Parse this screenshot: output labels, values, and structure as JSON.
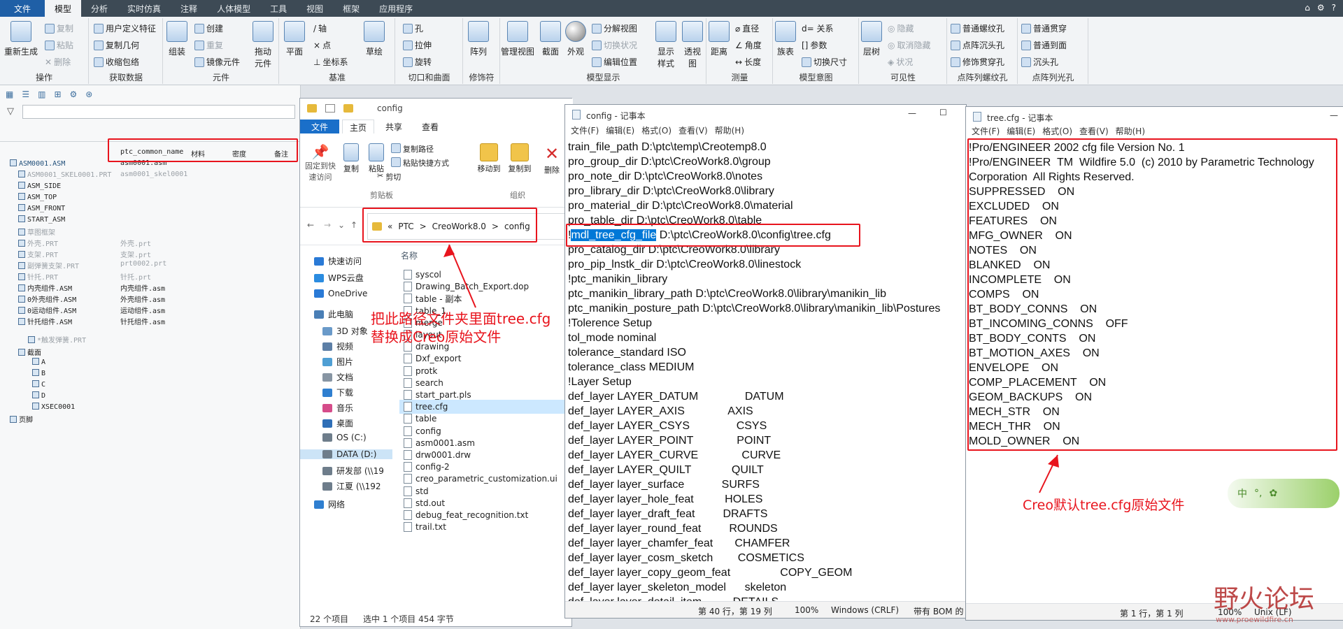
{
  "ribbon": {
    "tabs": [
      "文件",
      "模型",
      "分析",
      "实时仿真",
      "注释",
      "人体模型",
      "工具",
      "视图",
      "框架",
      "应用程序"
    ],
    "groups": {
      "operations": {
        "name": "操作",
        "regen": "重新生成",
        "copy": "复制",
        "paste": "粘贴",
        "delete": "删除"
      },
      "getdata": {
        "name": "获取数据",
        "udf": "用户定义特征",
        "copygeom": "复制几何",
        "shrinkwrap": "收缩包络"
      },
      "component": {
        "name": "元件",
        "assemble": "组装",
        "create": "创建",
        "repeat": "重复",
        "mirror": "镜像元件",
        "pull": "拖动元件"
      },
      "datum": {
        "name": "基准",
        "plane": "平面",
        "axis": "轴",
        "point": "点",
        "csys": "坐标系",
        "sketch": "草绘"
      },
      "cut": {
        "name": "切口和曲面",
        "hole": "孔",
        "extrude": "拉伸",
        "revolve": "旋转"
      },
      "modifier": {
        "name": "修饰符",
        "pattern": "阵列"
      },
      "display": {
        "name": "模型显示",
        "manage": "管理视图",
        "section": "截面",
        "appearance": "外观",
        "explode": "分解视图",
        "toggle": "切换状况",
        "editpos": "编辑位置",
        "style": "显示样式",
        "persp": "透视图"
      },
      "measure": {
        "name": "测量",
        "distance": "距离",
        "diameter": "直径",
        "angle": "角度",
        "length": "长度"
      },
      "intent": {
        "name": "模型意图",
        "table": "族表",
        "rel": "d= 关系",
        "params": "参数",
        "switchdim": "切换尺寸"
      },
      "visibility": {
        "name": "可见性",
        "layer": "层树",
        "hide": "隐藏",
        "unhide": "取消隐藏",
        "status": "状况"
      },
      "holes1": {
        "name": "点阵列螺纹孔",
        "a": "普通螺纹孔",
        "b": "点阵沉头孔",
        "c": "修饰贯穿孔"
      },
      "holes2": {
        "name": "点阵列光孔",
        "a": "普通贯穿",
        "b": "普通到面",
        "c": "沉头孔"
      }
    }
  },
  "tree": {
    "columns": [
      "ptc_common_name",
      "材料",
      "密度",
      "备注"
    ],
    "rows": [
      {
        "name": "ASM0001.ASM",
        "common": "asm0001.asm",
        "style": "blue"
      },
      {
        "name": "ASM0001_SKEL0001.PRT",
        "common": "asm0001_skel0001",
        "style": "g"
      },
      {
        "name": "ASM_SIDE",
        "common": "",
        "style": ""
      },
      {
        "name": "ASM_TOP",
        "common": "",
        "style": ""
      },
      {
        "name": "ASM_FRONT",
        "common": "",
        "style": ""
      },
      {
        "name": "START_ASM",
        "common": "",
        "style": ""
      },
      {
        "name": "草图框架",
        "common": "",
        "style": "g"
      },
      {
        "name": "外壳.PRT",
        "common": "外壳.prt",
        "style": "g"
      },
      {
        "name": "支架.PRT",
        "common": "支架.prt",
        "style": "g"
      },
      {
        "name": "副弹簧支架.PRT",
        "common": "prt0002.prt",
        "style": "g"
      },
      {
        "name": "针托.PRT",
        "common": "针托.prt",
        "style": "g"
      },
      {
        "name": "内壳组件.ASM",
        "common": "内壳组件.asm",
        "style": ""
      },
      {
        "name": "0外壳组件.ASM",
        "common": "外壳组件.asm",
        "style": ""
      },
      {
        "name": "0运动组件.ASM",
        "common": "运动组件.asm",
        "style": ""
      },
      {
        "name": "针托组件.ASM",
        "common": "针托组件.asm",
        "style": ""
      },
      {
        "name": "*触发弹簧.PRT",
        "common": "",
        "style": "g"
      },
      {
        "name": "截面",
        "common": "",
        "style": ""
      },
      {
        "name": "A",
        "common": "",
        "style": ""
      },
      {
        "name": "B",
        "common": "",
        "style": ""
      },
      {
        "name": "C",
        "common": "",
        "style": ""
      },
      {
        "name": "D",
        "common": "",
        "style": ""
      },
      {
        "name": "XSEC0001",
        "common": "",
        "style": ""
      },
      {
        "name": "页脚",
        "common": "",
        "style": ""
      }
    ]
  },
  "explorer": {
    "title": "config",
    "tabs": [
      "文件",
      "主页",
      "共享",
      "查看"
    ],
    "ribbon": {
      "pin": "固定到快速访问",
      "copy": "复制",
      "paste": "粘贴",
      "copypath": "复制路径",
      "pasteshortcut": "粘贴快捷方式",
      "cut": "剪切",
      "clipboard": "剪贴板",
      "moveto": "移动到",
      "copyto": "复制到",
      "del": "删除",
      "organize": "组织"
    },
    "breadcrumb": [
      "«",
      "PTC",
      ">",
      "CreoWork8.0",
      ">",
      "config"
    ],
    "nav": [
      "快速访问",
      "WPS云盘",
      "OneDrive",
      "此电脑",
      "3D 对象",
      "视频",
      "图片",
      "文档",
      "下载",
      "音乐",
      "桌面",
      "OS (C:)",
      "DATA (D:)",
      "研发部 (\\\\19",
      "江夏 (\\\\192",
      "网络"
    ],
    "column": "名称",
    "files": [
      "syscol",
      "Drawing_Batch_Export.dop",
      "table - 副本",
      "table_1",
      "merge",
      "layout",
      "drawing",
      "Dxf_export",
      "protk",
      "search",
      "start_part.pls",
      "tree.cfg",
      "table",
      "config",
      "asm0001.asm",
      "drw0001.drw",
      "config-2",
      "creo_parametric_customization.ui",
      "std",
      "std.out",
      "debug_feat_recognition.txt",
      "trail.txt"
    ],
    "status": {
      "count": "22 个项目",
      "selected": "选中 1 个项目  454 字节"
    }
  },
  "notepad1": {
    "title": "config - 记事本",
    "menu": [
      "文件(F)",
      "编辑(E)",
      "格式(O)",
      "查看(V)",
      "帮助(H)"
    ],
    "lines": [
      "train_file_path D:\\ptc\\temp\\Creotemp8.0",
      "pro_group_dir D:\\ptc\\CreoWork8.0\\group",
      "pro_note_dir D:\\ptc\\CreoWork8.0\\notes",
      "pro_library_dir D:\\ptc\\CreoWork8.0\\library",
      "pro_material_dir D:\\ptc\\CreoWork8.0\\material",
      "pro_table_dir D:\\ptc\\CreoWork8.0\\table",
      "!mdl_tree_cfg_file D:\\ptc\\CreoWork8.0\\config\\tree.cfg",
      "pro_catalog_dir D:\\ptc\\CreoWork8.0\\library",
      "pro_pip_lnstk_dir D:\\ptc\\CreoWork8.0\\linestock",
      "!ptc_manikin_library",
      "ptc_manikin_library_path D:\\ptc\\CreoWork8.0\\library\\manikin_lib",
      "ptc_manikin_posture_path D:\\ptc\\CreoWork8.0\\library\\manikin_lib\\Postures",
      "!Tolerence Setup",
      "tol_mode nominal",
      "tolerance_standard ISO",
      "tolerance_class MEDIUM",
      "!Layer Setup",
      "def_layer LAYER_DATUM               DATUM",
      "def_layer LAYER_AXIS              AXIS",
      "def_layer LAYER_CSYS               CSYS",
      "def_layer LAYER_POINT              POINT",
      "def_layer LAYER_CURVE              CURVE",
      "def_layer LAYER_QUILT             QUILT",
      "def_layer layer_surface            SURFS",
      "def_layer layer_hole_feat          HOLES",
      "def_layer layer_draft_feat         DRAFTS",
      "def_layer layer_round_feat         ROUNDS",
      "def_layer layer_chamfer_feat       CHAMFER",
      "def_layer layer_cosm_sketch        COSMETICS",
      "def_layer layer_copy_geom_feat                COPY_GEOM",
      "def_layer layer_skeleton_model      skeleton",
      "def_layer layer_detail_item          DETAILS"
    ],
    "status": {
      "pos": "第 40 行，第 19 列",
      "zoom": "100%",
      "eol": "Windows (CRLF)",
      "enc": "带有 BOM 的"
    }
  },
  "notepad2": {
    "title": "tree.cfg - 记事本",
    "menu": [
      "文件(F)",
      "编辑(E)",
      "格式(O)",
      "查看(V)",
      "帮助(H)"
    ],
    "lines": [
      "!Pro/ENGINEER 2002 cfg file Version No. 1",
      "!Pro/ENGINEER  TM  Wildfire 5.0  (c) 2010 by Parametric Technology",
      "Corporation  All Rights Reserved.",
      "SUPPRESSED    ON",
      "EXCLUDED    ON",
      "FEATURES    ON",
      "MFG_OWNER    ON",
      "NOTES    ON",
      "BLANKED    ON",
      "INCOMPLETE    ON",
      "COMPS    ON",
      "BT_BODY_CONNS    ON",
      "BT_INCOMING_CONNS    OFF",
      "BT_BODY_CONTS    ON",
      "BT_MOTION_AXES    ON",
      "ENVELOPE    ON",
      "COMP_PLACEMENT    ON",
      "GEOM_BACKUPS    ON",
      "MECH_STR    ON",
      "MECH_THR    ON",
      "MOLD_OWNER    ON"
    ],
    "status": {
      "pos": "第 1 行，第 1 列",
      "zoom": "100%",
      "eol": "Unix (LF)"
    }
  },
  "annotations": {
    "a1_line1": "把此路径文件夹里面tree.cfg",
    "a1_line2": "替换成Creo原始文件",
    "a2": "Creo默认tree.cfg原始文件",
    "highlight": "mdl_tree_cfg_file"
  },
  "watermark": {
    "text": "野火论坛",
    "url": "www.proewildfire.cn"
  },
  "colors": {
    "accent": "#1f5fa6",
    "annotation": "#e8141d",
    "selection": "#0078d7"
  }
}
